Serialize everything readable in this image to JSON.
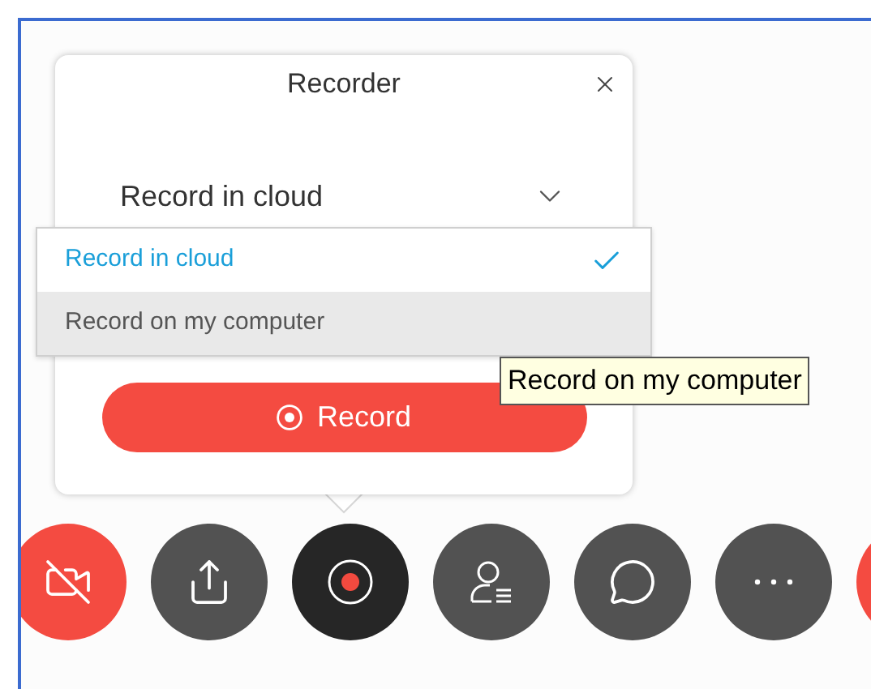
{
  "recorder": {
    "title": "Recorder",
    "mode_select": {
      "value": "Record in cloud",
      "expanded": true
    },
    "options": [
      {
        "label": "Record in cloud",
        "selected": true,
        "hovered": false
      },
      {
        "label": "Record on my computer",
        "selected": false,
        "hovered": true
      }
    ],
    "record_button": "Record"
  },
  "tooltip": "Record on my computer",
  "toolbar": [
    {
      "kind": "video-off",
      "selected": false
    },
    {
      "kind": "share",
      "selected": false
    },
    {
      "kind": "record",
      "selected": true
    },
    {
      "kind": "participants",
      "selected": false
    },
    {
      "kind": "chat",
      "selected": false
    },
    {
      "kind": "more",
      "selected": false
    },
    {
      "kind": "leave",
      "selected": false
    }
  ]
}
